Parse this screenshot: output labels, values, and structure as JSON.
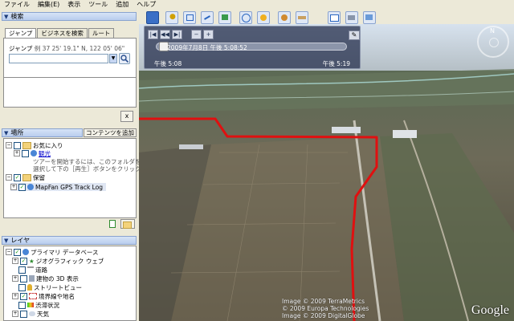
{
  "menu": [
    "ファイル",
    "編集(E)",
    "表示",
    "ツール",
    "追加",
    "ヘルプ"
  ],
  "search": {
    "header": "検索",
    "tabs": [
      "ジャンプ",
      "ビジネスを検索",
      "ルート"
    ],
    "jump_label": "ジャンプ",
    "jump_example": "例 37 25' 19.1\" N, 122 05' 06\" ",
    "clear_label": "x"
  },
  "places": {
    "header": "場所",
    "add_content": "コンテンツを追加",
    "favorites": "お気に入り",
    "sightseeing": "観光",
    "tour_hint_1": "ツアーを開始するには、このフォルダを",
    "tour_hint_2": "選択して下の［再生］ボタンをクリック",
    "saved": "保留",
    "track_log": "MapFan GPS Track Log"
  },
  "layers": {
    "header": "レイヤ",
    "items": [
      "プライマリ データベース",
      "ジオグラフィック ウェブ",
      "道路",
      "建物の 3D 表示",
      "ストリートビュー",
      "境界線や地名",
      "渋滞状況",
      "天気"
    ]
  },
  "time_panel": {
    "current": "2009年7月8日 午後 5:08:52",
    "start": "午後 5:08",
    "end": "午後 5:19",
    "position": 0.02
  },
  "copyright": [
    "Image © 2009 TerraMetrics",
    "© 2009 Europa Technologies",
    "Image © 2009 DigitalGlobe"
  ],
  "brand": "Google",
  "compass_north": "N",
  "colors": {
    "track": "#e01010",
    "panel_header": "#c7d7f1"
  }
}
